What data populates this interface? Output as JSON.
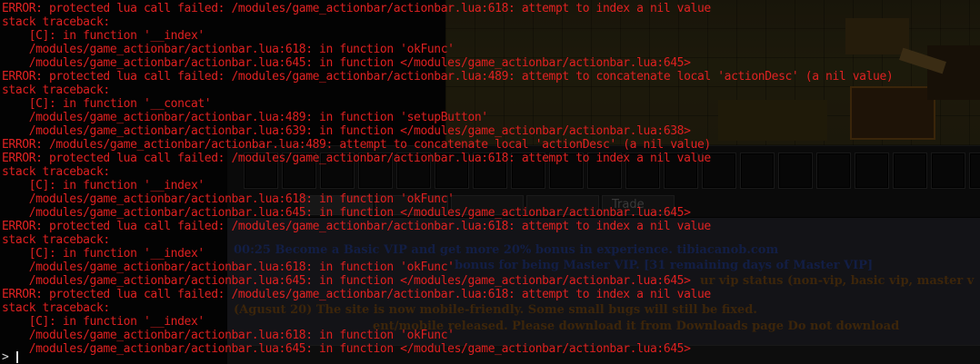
{
  "game": {
    "tabs": [
      {
        "label": "",
        "active": true
      },
      {
        "label": "",
        "active": false
      },
      {
        "label": "",
        "active": false
      },
      {
        "label": "",
        "active": false
      },
      {
        "label": "Trade",
        "active": false
      }
    ],
    "chat": [
      {
        "text": "00:25 Become a Basic VIP and get more 20% bonus in experience. tibiacanob.com",
        "tone": "blue"
      },
      {
        "text": "bonus for being Master VIP. [31 remaining days of Master VIP]",
        "tone": "blue"
      },
      {
        "text": "ur vip status (non-vip, basic vip, master v",
        "tone": "orange"
      },
      {
        "text": "(Agusut 20) The site is now mobile-friendly. Some small bugs will still be fixed.",
        "tone": "orange"
      },
      {
        "text": "ent/mobile released. Please download it from Downloads page Do not download",
        "tone": "orange"
      }
    ]
  },
  "terminal": {
    "lines": [
      {
        "text": "ERROR: protected lua call failed: /modules/game_actionbar/actionbar.lua:618: attempt to index a nil value",
        "kind": "error"
      },
      {
        "text": "stack traceback:",
        "kind": "trace"
      },
      {
        "text": "    [C]: in function '__index'",
        "kind": "trace"
      },
      {
        "text": "    /modules/game_actionbar/actionbar.lua:618: in function 'okFunc'",
        "kind": "trace"
      },
      {
        "text": "    /modules/game_actionbar/actionbar.lua:645: in function </modules/game_actionbar/actionbar.lua:645>",
        "kind": "trace"
      },
      {
        "text": "ERROR: protected lua call failed: /modules/game_actionbar/actionbar.lua:489: attempt to concatenate local 'actionDesc' (a nil value)",
        "kind": "error"
      },
      {
        "text": "stack traceback:",
        "kind": "trace"
      },
      {
        "text": "    [C]: in function '__concat'",
        "kind": "trace"
      },
      {
        "text": "    /modules/game_actionbar/actionbar.lua:489: in function 'setupButton'",
        "kind": "trace"
      },
      {
        "text": "    /modules/game_actionbar/actionbar.lua:639: in function </modules/game_actionbar/actionbar.lua:638>",
        "kind": "trace"
      },
      {
        "text": "ERROR: /modules/game_actionbar/actionbar.lua:489: attempt to concatenate local 'actionDesc' (a nil value)",
        "kind": "error"
      },
      {
        "text": "ERROR: protected lua call failed: /modules/game_actionbar/actionbar.lua:618: attempt to index a nil value",
        "kind": "error"
      },
      {
        "text": "stack traceback:",
        "kind": "trace"
      },
      {
        "text": "    [C]: in function '__index'",
        "kind": "trace"
      },
      {
        "text": "    /modules/game_actionbar/actionbar.lua:618: in function 'okFunc'",
        "kind": "trace"
      },
      {
        "text": "    /modules/game_actionbar/actionbar.lua:645: in function </modules/game_actionbar/actionbar.lua:645>",
        "kind": "trace"
      },
      {
        "text": "ERROR: protected lua call failed: /modules/game_actionbar/actionbar.lua:618: attempt to index a nil value",
        "kind": "error"
      },
      {
        "text": "stack traceback:",
        "kind": "trace"
      },
      {
        "text": "    [C]: in function '__index'",
        "kind": "trace"
      },
      {
        "text": "    /modules/game_actionbar/actionbar.lua:618: in function 'okFunc'",
        "kind": "trace"
      },
      {
        "text": "    /modules/game_actionbar/actionbar.lua:645: in function </modules/game_actionbar/actionbar.lua:645>",
        "kind": "trace"
      },
      {
        "text": "ERROR: protected lua call failed: /modules/game_actionbar/actionbar.lua:618: attempt to index a nil value",
        "kind": "error"
      },
      {
        "text": "stack traceback:",
        "kind": "trace"
      },
      {
        "text": "    [C]: in function '__index'",
        "kind": "trace"
      },
      {
        "text": "    /modules/game_actionbar/actionbar.lua:618: in function 'okFunc'",
        "kind": "trace"
      },
      {
        "text": "    /modules/game_actionbar/actionbar.lua:645: in function </modules/game_actionbar/actionbar.lua:645>",
        "kind": "trace"
      }
    ],
    "prompt": ">"
  },
  "colors": {
    "error_text": "#e02222",
    "terminal_bg": "#050505",
    "chat_blue": "#1d2e6a",
    "chat_orange": "#5c3a10"
  }
}
